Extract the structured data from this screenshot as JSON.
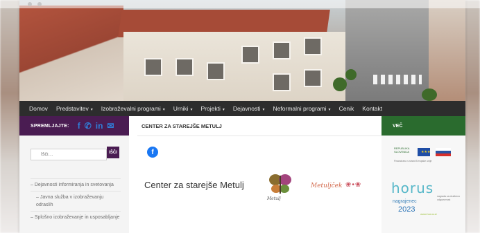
{
  "nav": {
    "items": [
      {
        "label": "Domov",
        "dropdown": false
      },
      {
        "label": "Predstavitev",
        "dropdown": true
      },
      {
        "label": "Izobraževalni programi",
        "dropdown": true
      },
      {
        "label": "Urniki",
        "dropdown": true
      },
      {
        "label": "Projekti",
        "dropdown": true
      },
      {
        "label": "Dejavnosti",
        "dropdown": true
      },
      {
        "label": "Neformalni programi",
        "dropdown": true
      },
      {
        "label": "Cenik",
        "dropdown": false
      },
      {
        "label": "Kontakt",
        "dropdown": false
      }
    ],
    "caret": "▾"
  },
  "sidebar_left": {
    "follow_label": "SPREMLJAJTE:",
    "social": [
      {
        "icon": "facebook-icon",
        "glyph": "f"
      },
      {
        "icon": "phone-icon",
        "glyph": "✆"
      },
      {
        "icon": "linkedin-icon",
        "glyph": "in"
      },
      {
        "icon": "mail-icon",
        "glyph": "✉"
      }
    ],
    "search_placeholder": "Išči…",
    "search_button": "IŠČI",
    "menu": [
      {
        "label": "– Dejavnosti informiranja in svetovanja",
        "sub": false
      },
      {
        "label": "– Javna služba v izobraževanju odraslih",
        "sub": true
      },
      {
        "label": "– Splošno izobraževanje in usposabljanje",
        "sub": false
      }
    ]
  },
  "main": {
    "section_title": "CENTER ZA STAREJŠE METULJ",
    "fb_glyph": "f",
    "heading": "Center za starejše Metulj",
    "logo_label": "Metulj",
    "script_logo": "Metuljček",
    "script_dots": "❀•❀"
  },
  "sidebar_right": {
    "title": "VEČ",
    "eu_text": "REPUBLIKA SLOVENIJA",
    "eu_note": "Financirano s strani Evropske unije",
    "horus_name": "horus",
    "horus_side": "nagrada za družbeno odgovornost",
    "horus_award": "nagrajenec",
    "horus_year": "2023",
    "horus_site": "www.horus.si"
  },
  "colors": {
    "nav_bg": "#2d2d2d",
    "follow_bg": "#4a1c52",
    "vec_bg": "#2a6b2e",
    "facebook": "#1977f3"
  }
}
